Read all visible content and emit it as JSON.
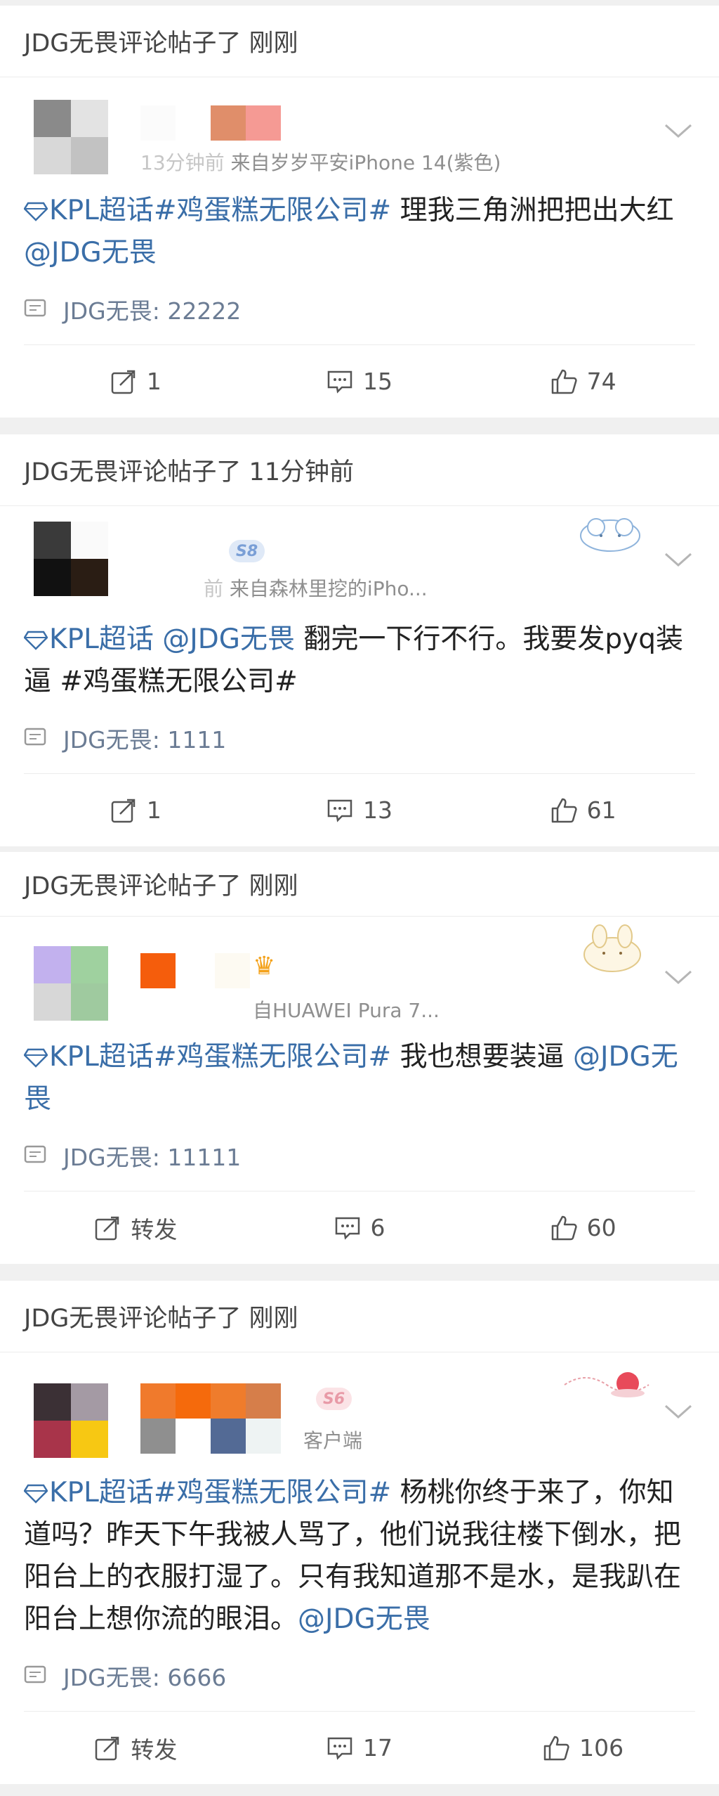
{
  "posts": [
    {
      "header": "JDG无畏评论帖子了 刚刚",
      "meta_prefix": "13分钟前",
      "meta_source": "来自岁岁平安iPhone 14(紫色)",
      "badge": "",
      "content": {
        "topic_prefix": "KPL超话#鸡蛋糕无限公司#",
        "text": " 理我三角洲把把出大红 ",
        "mention": "@JDG无畏",
        "suffix": ""
      },
      "comment": "JDG无畏: 22222",
      "repost_label": "1",
      "comment_count": "15",
      "like_count": "74"
    },
    {
      "header": "JDG无畏评论帖子了 11分钟前",
      "meta_prefix": "前",
      "meta_source": "来自森林里挖的iPho...",
      "badge": "S8",
      "content": {
        "topic_prefix": "KPL超话 ",
        "text": "",
        "mention": "@JDG无畏",
        "suffix": " 翻完一下行不行。我要发pyq装逼 #鸡蛋糕无限公司#"
      },
      "comment": "JDG无畏: 1111",
      "repost_label": "1",
      "comment_count": "13",
      "like_count": "61"
    },
    {
      "header": "JDG无畏评论帖子了 刚刚",
      "meta_prefix": "",
      "meta_source": "自HUAWEI Pura 7...",
      "badge": "",
      "content": {
        "topic_prefix": "KPL超话#鸡蛋糕无限公司#",
        "text": " 我也想要装逼 ",
        "mention": "@JDG无畏",
        "suffix": ""
      },
      "comment": "JDG无畏: 11111",
      "repost_label": "转发",
      "comment_count": "6",
      "like_count": "60"
    },
    {
      "header": "JDG无畏评论帖子了 刚刚",
      "meta_prefix": "",
      "meta_source": "客户端",
      "badge": "S6",
      "content": {
        "topic_prefix": "KPL超话#鸡蛋糕无限公司#",
        "text": " 杨桃你终于来了，你知道吗？昨天下午我被人骂了，他们说我往楼下倒水，把阳台上的衣服打湿了。只有我知道那不是水，是我趴在阳台上想你流的眼泪。",
        "mention": "@JDG无畏",
        "suffix": ""
      },
      "comment": "JDG无畏: 6666",
      "repost_label": "转发",
      "comment_count": "17",
      "like_count": "106"
    }
  ],
  "colors": {
    "topic": "#3a6ea8",
    "comment_text": "#6b7c94",
    "background": "#f0f0f0"
  },
  "icons": {
    "repost": "repost-icon",
    "comment": "comment-icon",
    "like": "like-icon",
    "chevron": "chevron-down-icon",
    "gem": "gem-icon"
  }
}
